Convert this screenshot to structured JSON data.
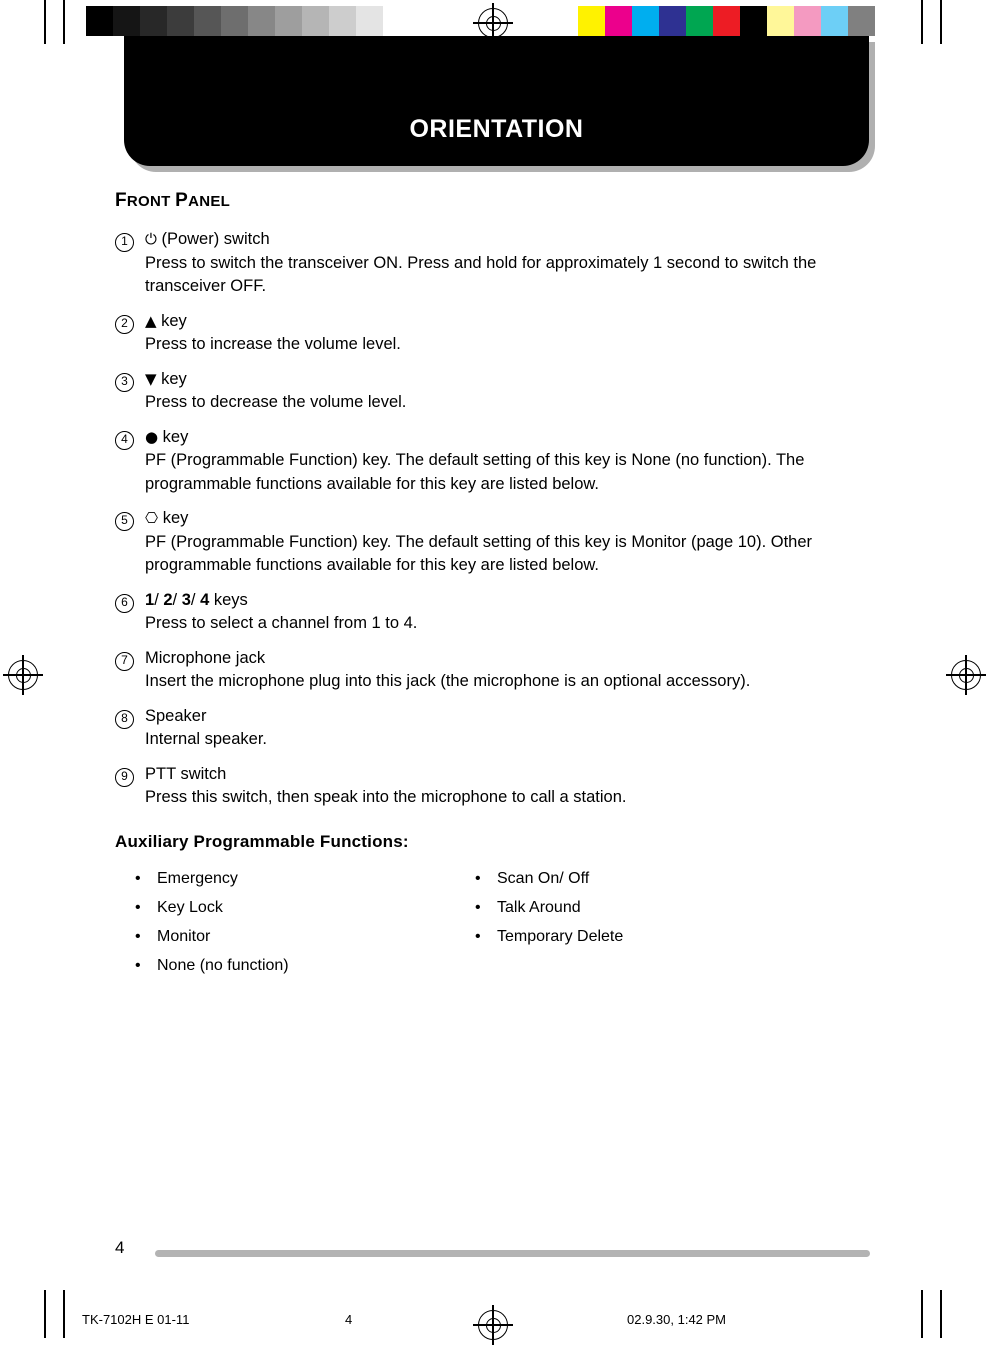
{
  "banner": {
    "title": "ORIENTATION"
  },
  "section": {
    "title_first": "F",
    "title_rest": "RONT ",
    "title_first2": "P",
    "title_rest2": "ANEL"
  },
  "items": [
    {
      "num": "1",
      "glyph": "⏻",
      "title": " (Power) switch",
      "desc": "Press to switch the transceiver ON.  Press and hold for approximately 1 second to switch the transceiver OFF."
    },
    {
      "num": "2",
      "glyph": "▲",
      "title": " key",
      "desc": "Press to increase the volume level."
    },
    {
      "num": "3",
      "glyph": "▼",
      "title": " key",
      "desc": "Press to decrease the volume level."
    },
    {
      "num": "4",
      "glyph": "●",
      "title": " key",
      "desc": "PF (Programmable Function) key.  The default setting of this key is None (no function).  The programmable functions available for this key are listed below."
    },
    {
      "num": "5",
      "glyph": "⎔",
      "title": " key",
      "desc": "PF (Programmable Function) key.  The default setting of this key is Monitor (page 10).  Other programmable functions available for this key are listed below."
    },
    {
      "num": "6",
      "glyph": "",
      "title_parts": [
        "1",
        "/ ",
        "2",
        "/ ",
        "3",
        "/ ",
        "4",
        " keys"
      ],
      "desc": "Press to select a channel from 1 to 4."
    },
    {
      "num": "7",
      "glyph": "",
      "title": "Microphone jack",
      "desc": "Insert the microphone plug into this jack (the microphone is an optional accessory)."
    },
    {
      "num": "8",
      "glyph": "",
      "title": "Speaker",
      "desc": "Internal speaker."
    },
    {
      "num": "9",
      "glyph": "",
      "title": "PTT switch",
      "desc": "Press this switch, then speak into the microphone to call a station."
    }
  ],
  "auxiliary": {
    "title": "Auxiliary Programmable Functions:",
    "bullet": "•",
    "left_column": [
      "Emergency",
      "Key Lock",
      "Monitor",
      "None (no function)"
    ],
    "right_column": [
      "Scan On/ Off",
      "Talk Around",
      "Temporary Delete"
    ]
  },
  "footer": {
    "page_number": "4",
    "meta_left": "TK-7102H E 01-11",
    "meta_mid": "4",
    "meta_right": "02.9.30, 1:42 PM"
  },
  "colors": {
    "grey_bar": [
      "#000000",
      "#151515",
      "#282828",
      "#3c3c3c",
      "#565656",
      "#6e6e6e",
      "#878787",
      "#9e9e9e",
      "#b5b5b5",
      "#cdcdcd",
      "#e4e4e4",
      "#ffffff"
    ],
    "color_bar": [
      "#fff200",
      "#ec008c",
      "#00aeef",
      "#2e3192",
      "#00a651",
      "#ed1c24",
      "#000000",
      "#fff799",
      "#f49ac1",
      "#6dcff6",
      "#808080"
    ]
  }
}
